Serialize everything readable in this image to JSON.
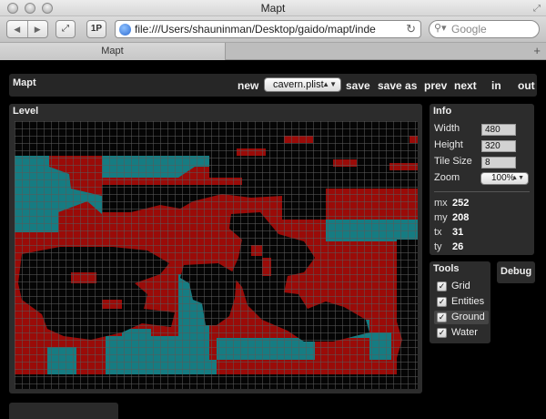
{
  "window": {
    "title": "Mapt"
  },
  "toolbar": {
    "back_icon": "◀",
    "forward_icon": "▶",
    "fullscreen_icon": "⤢",
    "onep_label": "1P",
    "url": "file:///Users/shauninman/Desktop/gaido/mapt/inde",
    "search_placeholder": "Google"
  },
  "tab": {
    "label": "Mapt"
  },
  "app": {
    "title": "Mapt",
    "menu": {
      "new": "new",
      "file": "cavern.plist",
      "save": "save",
      "save_as": "save as",
      "prev": "prev",
      "next": "next",
      "in": "in",
      "out": "out"
    }
  },
  "level": {
    "title": "Level"
  },
  "info": {
    "title": "Info",
    "width_label": "Width",
    "width_value": "480",
    "height_label": "Height",
    "height_value": "320",
    "tilesize_label": "Tile Size",
    "tilesize_value": "8",
    "zoom_label": "Zoom",
    "zoom_value": "100%",
    "mx_label": "mx",
    "mx_value": "252",
    "my_label": "my",
    "my_value": "208",
    "tx_label": "tx",
    "tx_value": "31",
    "ty_label": "ty",
    "ty_value": "26"
  },
  "tools": {
    "title": "Tools",
    "items": [
      {
        "label": "Grid",
        "checked": true
      },
      {
        "label": "Entities",
        "checked": true
      },
      {
        "label": "Ground",
        "checked": true,
        "active": true
      },
      {
        "label": "Water",
        "checked": true
      }
    ]
  },
  "debug": {
    "title": "Debug"
  },
  "colors": {
    "ground": "#9a0b08",
    "water": "#167c82",
    "empty": "#050505",
    "grid": "#5a5a5a"
  }
}
